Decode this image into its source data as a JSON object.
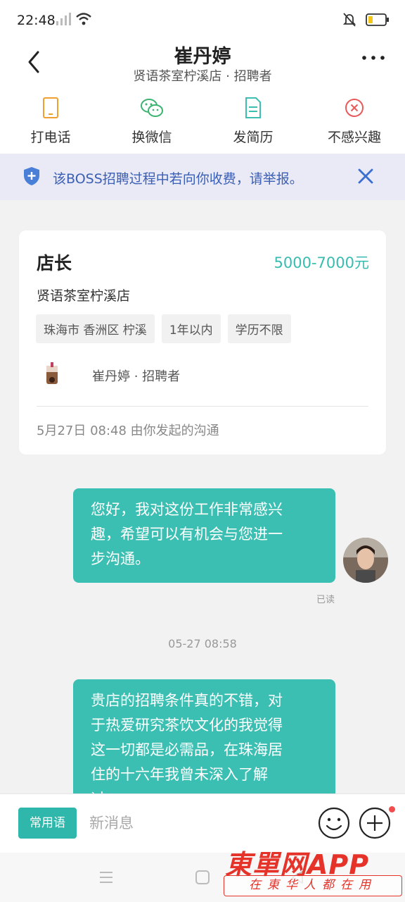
{
  "status_bar": {
    "time": "22:48"
  },
  "header": {
    "title": "崔丹婷",
    "subtitle": "贤语茶室柠溪店 · 招聘者"
  },
  "actions": [
    {
      "label": "打电话",
      "icon": "phone-icon"
    },
    {
      "label": "换微信",
      "icon": "wechat-icon"
    },
    {
      "label": "发简历",
      "icon": "resume-icon"
    },
    {
      "label": "不感兴趣",
      "icon": "not-interested-icon"
    }
  ],
  "notice": {
    "text": "该BOSS招聘过程中若向你收费，请举报。"
  },
  "job_card": {
    "title": "店长",
    "salary": "5000-7000元",
    "company": "贤语茶室柠溪店",
    "tags": [
      "珠海市 香洲区 柠溪",
      "1年以内",
      "学历不限"
    ],
    "recruiter": "崔丹婷 · 招聘者",
    "footer": "5月27日 08:48 由你发起的沟通"
  },
  "messages": [
    {
      "lines": [
        "您好，我对这份工作非常感兴",
        "趣，希望可以有机会与您进一",
        "步沟通。"
      ],
      "read": "已读"
    },
    {
      "timestamp": "05-27 08:58"
    },
    {
      "lines": [
        "贵店的招聘条件真的不错，对",
        "于热爱研究茶饮文化的我觉得",
        "这一切都是必需品，在珠海居",
        "住的十六年我曾未深入了解",
        "过，…"
      ]
    }
  ],
  "input_bar": {
    "quick_phrases": "常用语",
    "placeholder": "新消息"
  },
  "watermark": {
    "top": "東單网APP",
    "bottom": "在東华人都在用"
  },
  "colors": {
    "accent": "#3bbfb2",
    "notice_bg": "#e9eaf6",
    "notice_text": "#3a5fb5",
    "salary": "#38bcb1"
  }
}
